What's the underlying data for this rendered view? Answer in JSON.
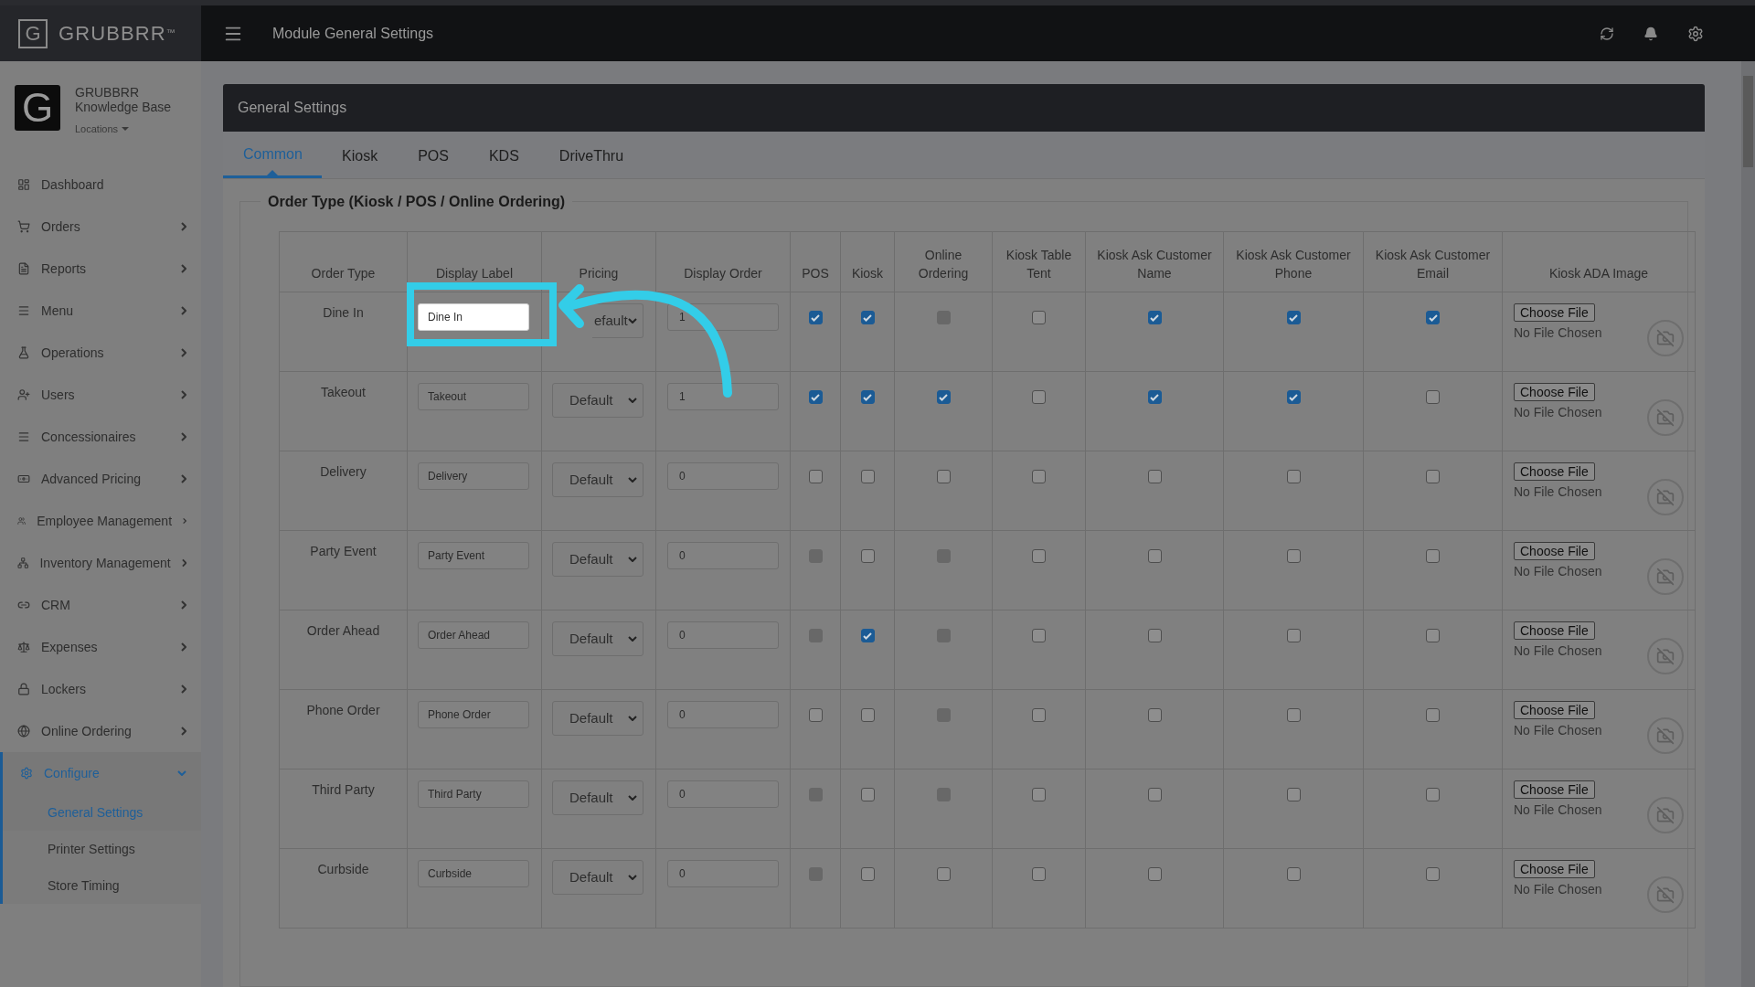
{
  "brand": {
    "logo_letter": "G",
    "name": "GRUBBRR",
    "trademark": "™"
  },
  "topbar": {
    "title": "Module General Settings"
  },
  "account": {
    "logo_letter": "G",
    "name": "GRUBBRR",
    "subtitle": "Knowledge Base",
    "locations": "Locations"
  },
  "sidebar": {
    "items": [
      {
        "label": "Dashboard",
        "has_children": false,
        "selected": false
      },
      {
        "label": "Orders",
        "has_children": true,
        "selected": false
      },
      {
        "label": "Reports",
        "has_children": true,
        "selected": false
      },
      {
        "label": "Menu",
        "has_children": true,
        "selected": false
      },
      {
        "label": "Operations",
        "has_children": true,
        "selected": false
      },
      {
        "label": "Users",
        "has_children": true,
        "selected": false
      },
      {
        "label": "Concessionaires",
        "has_children": true,
        "selected": false
      },
      {
        "label": "Advanced Pricing",
        "has_children": true,
        "selected": false
      },
      {
        "label": "Employee Management",
        "has_children": true,
        "selected": false
      },
      {
        "label": "Inventory Management",
        "has_children": true,
        "selected": false
      },
      {
        "label": "CRM",
        "has_children": true,
        "selected": false
      },
      {
        "label": "Expenses",
        "has_children": true,
        "selected": false
      },
      {
        "label": "Lockers",
        "has_children": true,
        "selected": false
      },
      {
        "label": "Online Ordering",
        "has_children": true,
        "selected": false
      },
      {
        "label": "Configure",
        "has_children": true,
        "selected": true,
        "expanded": true,
        "children": [
          {
            "label": "General Settings",
            "selected": true
          },
          {
            "label": "Printer Settings",
            "selected": false
          },
          {
            "label": "Store Timing",
            "selected": false
          }
        ]
      }
    ]
  },
  "panel": {
    "title": "General Settings"
  },
  "tabs": [
    {
      "label": "Common",
      "selected": true
    },
    {
      "label": "Kiosk",
      "selected": false
    },
    {
      "label": "POS",
      "selected": false
    },
    {
      "label": "KDS",
      "selected": false
    },
    {
      "label": "DriveThru",
      "selected": false
    }
  ],
  "section": {
    "title": "Order Type (Kiosk / POS / Online Ordering)"
  },
  "table": {
    "columns": [
      "Order Type",
      "Display Label",
      "Pricing",
      "Display Order",
      "POS",
      "Kiosk",
      "Online Ordering",
      "Kiosk Table Tent",
      "Kiosk Ask Customer Name",
      "Kiosk Ask Customer Phone",
      "Kiosk Ask Customer Email",
      "Kiosk ADA Image"
    ],
    "rows": [
      {
        "order_type": "Dine In",
        "label": "Dine In",
        "pricing": "efault",
        "display_order": "1",
        "highlighted": true,
        "checks": [
          {
            "checked": true,
            "disabled": false
          },
          {
            "checked": true,
            "disabled": false
          },
          {
            "checked": false,
            "disabled": true
          },
          {
            "checked": false,
            "disabled": false
          },
          {
            "checked": true,
            "disabled": false
          },
          {
            "checked": true,
            "disabled": false
          },
          {
            "checked": true,
            "disabled": false
          }
        ],
        "file_button": "Choose File",
        "file_status": "No File Chosen"
      },
      {
        "order_type": "Takeout",
        "label": "Takeout",
        "pricing": "Default",
        "display_order": "1",
        "highlighted": false,
        "checks": [
          {
            "checked": true,
            "disabled": false
          },
          {
            "checked": true,
            "disabled": false
          },
          {
            "checked": true,
            "disabled": false
          },
          {
            "checked": false,
            "disabled": false
          },
          {
            "checked": true,
            "disabled": false
          },
          {
            "checked": true,
            "disabled": false
          },
          {
            "checked": false,
            "disabled": false
          }
        ],
        "file_button": "Choose File",
        "file_status": "No File Chosen"
      },
      {
        "order_type": "Delivery",
        "label": "Delivery",
        "pricing": "Default",
        "display_order": "0",
        "highlighted": false,
        "checks": [
          {
            "checked": false,
            "disabled": false
          },
          {
            "checked": false,
            "disabled": false
          },
          {
            "checked": false,
            "disabled": false
          },
          {
            "checked": false,
            "disabled": false
          },
          {
            "checked": false,
            "disabled": false
          },
          {
            "checked": false,
            "disabled": false
          },
          {
            "checked": false,
            "disabled": false
          }
        ],
        "file_button": "Choose File",
        "file_status": "No File Chosen"
      },
      {
        "order_type": "Party Event",
        "label": "Party Event",
        "pricing": "Default",
        "display_order": "0",
        "highlighted": false,
        "checks": [
          {
            "checked": false,
            "disabled": true
          },
          {
            "checked": false,
            "disabled": false
          },
          {
            "checked": false,
            "disabled": true
          },
          {
            "checked": false,
            "disabled": false
          },
          {
            "checked": false,
            "disabled": false
          },
          {
            "checked": false,
            "disabled": false
          },
          {
            "checked": false,
            "disabled": false
          }
        ],
        "file_button": "Choose File",
        "file_status": "No File Chosen"
      },
      {
        "order_type": "Order Ahead",
        "label": "Order Ahead",
        "pricing": "Default",
        "display_order": "0",
        "highlighted": false,
        "checks": [
          {
            "checked": false,
            "disabled": true
          },
          {
            "checked": true,
            "disabled": false
          },
          {
            "checked": false,
            "disabled": true
          },
          {
            "checked": false,
            "disabled": false
          },
          {
            "checked": false,
            "disabled": false
          },
          {
            "checked": false,
            "disabled": false
          },
          {
            "checked": false,
            "disabled": false
          }
        ],
        "file_button": "Choose File",
        "file_status": "No File Chosen"
      },
      {
        "order_type": "Phone Order",
        "label": "Phone Order",
        "pricing": "Default",
        "display_order": "0",
        "highlighted": false,
        "checks": [
          {
            "checked": false,
            "disabled": false
          },
          {
            "checked": false,
            "disabled": false
          },
          {
            "checked": false,
            "disabled": true
          },
          {
            "checked": false,
            "disabled": false
          },
          {
            "checked": false,
            "disabled": false
          },
          {
            "checked": false,
            "disabled": false
          },
          {
            "checked": false,
            "disabled": false
          }
        ],
        "file_button": "Choose File",
        "file_status": "No File Chosen"
      },
      {
        "order_type": "Third Party",
        "label": "Third Party",
        "pricing": "Default",
        "display_order": "0",
        "highlighted": false,
        "checks": [
          {
            "checked": false,
            "disabled": true
          },
          {
            "checked": false,
            "disabled": false
          },
          {
            "checked": false,
            "disabled": true
          },
          {
            "checked": false,
            "disabled": false
          },
          {
            "checked": false,
            "disabled": false
          },
          {
            "checked": false,
            "disabled": false
          },
          {
            "checked": false,
            "disabled": false
          }
        ],
        "file_button": "Choose File",
        "file_status": "No File Chosen"
      },
      {
        "order_type": "Curbside",
        "label": "Curbside",
        "pricing": "Default",
        "display_order": "0",
        "highlighted": false,
        "checks": [
          {
            "checked": false,
            "disabled": true
          },
          {
            "checked": false,
            "disabled": false
          },
          {
            "checked": false,
            "disabled": false
          },
          {
            "checked": false,
            "disabled": false
          },
          {
            "checked": false,
            "disabled": false
          },
          {
            "checked": false,
            "disabled": false
          },
          {
            "checked": false,
            "disabled": false
          }
        ],
        "file_button": "Choose File",
        "file_status": "No File Chosen"
      }
    ]
  }
}
